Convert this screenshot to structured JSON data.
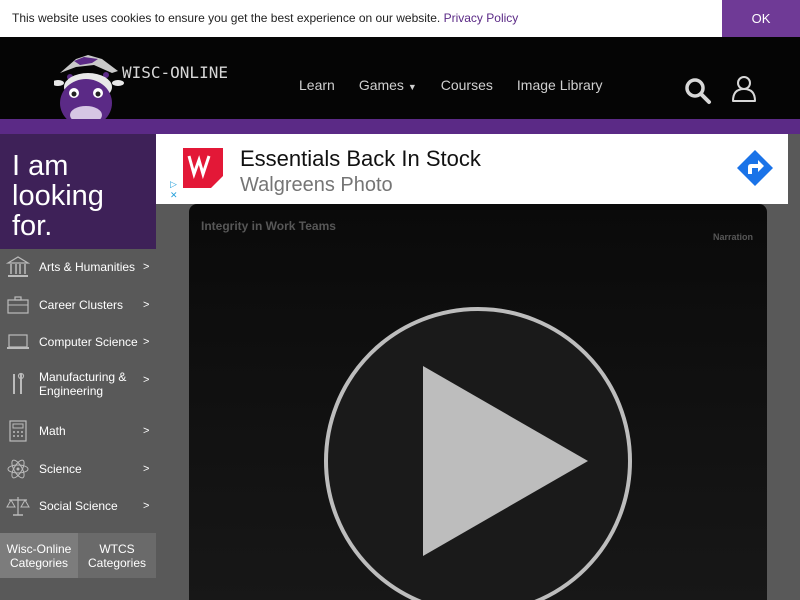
{
  "cookie": {
    "message": "This website uses cookies to ensure you get the best experience on our website.",
    "policy_link": "Privacy Policy",
    "ok_label": "OK"
  },
  "header": {
    "logo_text": "WISC-ONLINE",
    "nav": [
      {
        "label": "Learn"
      },
      {
        "label": "Games",
        "has_dropdown": true
      },
      {
        "label": "Courses"
      },
      {
        "label": "Image Library"
      }
    ],
    "icons": [
      "search-icon",
      "user-icon"
    ]
  },
  "sidebar": {
    "heading": "I am looking for.",
    "heading_lines": [
      "I am",
      "looking",
      "for."
    ],
    "categories": [
      {
        "label": "Arts & Humanities",
        "icon": "building-icon"
      },
      {
        "label": "Career Clusters",
        "icon": "briefcase-icon"
      },
      {
        "label": "Computer Science",
        "icon": "laptop-icon"
      },
      {
        "label": "Manufacturing & Engineering",
        "icon": "tools-icon"
      },
      {
        "label": "Math",
        "icon": "calculator-icon"
      },
      {
        "label": "Science",
        "icon": "atom-icon"
      },
      {
        "label": "Social Science",
        "icon": "scales-icon"
      }
    ],
    "arrow": ">",
    "buttons": [
      "Wisc-Online Categories",
      "WTCS Categories"
    ]
  },
  "ad": {
    "title": "Essentials Back In Stock",
    "subtitle": "Walgreens Photo",
    "logo": "walgreens-logo",
    "cta_icon": "directions-arrow-icon"
  },
  "video": {
    "title": "Integrity in Work Teams",
    "narration_label": "Narration",
    "play_icon": "play-icon"
  },
  "colors": {
    "brand_purple": "#5b2a86",
    "dark_purple": "#3e2158",
    "header_bg": "#050505",
    "sidebar_bg": "#595959",
    "walgreens_red": "#e31837",
    "ad_cta_blue": "#1a73e8"
  }
}
